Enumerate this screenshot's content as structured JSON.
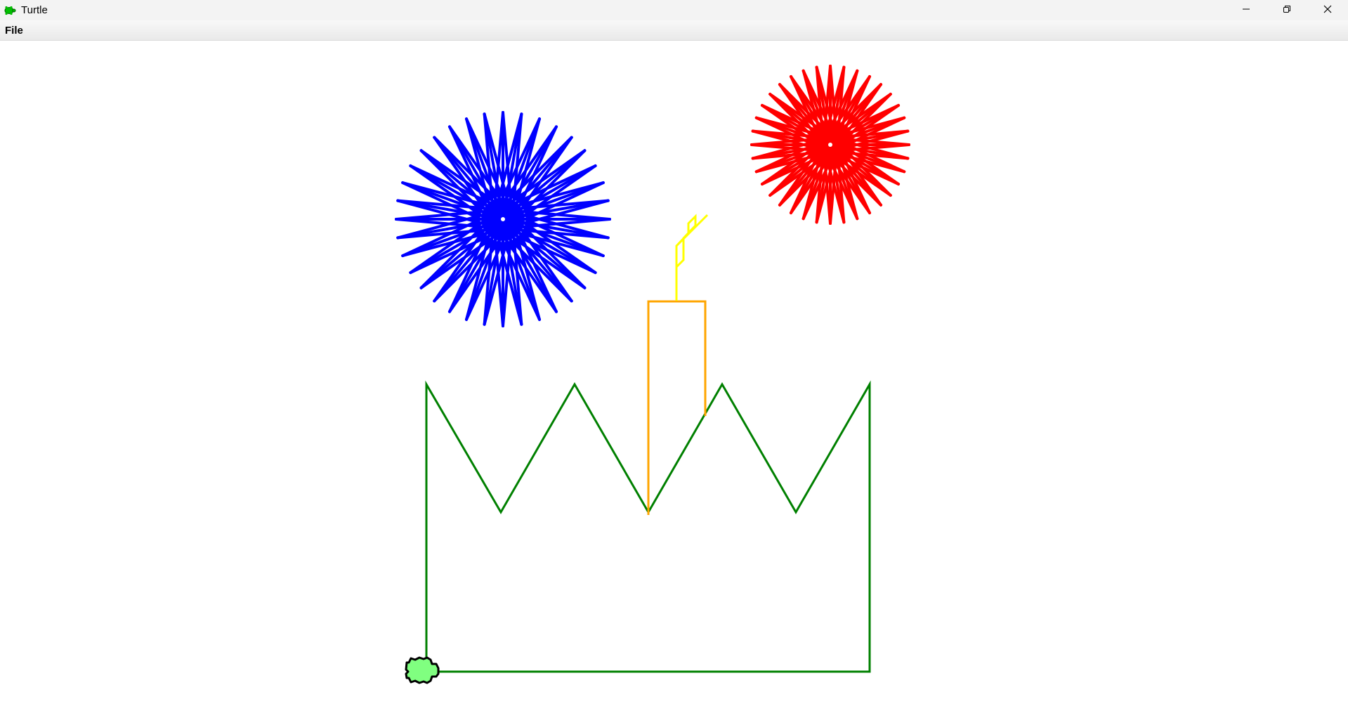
{
  "window": {
    "title": "Turtle",
    "app_icon": "turtle-icon",
    "controls": [
      "minimize-icon",
      "restore-icon",
      "close-icon"
    ]
  },
  "menu": {
    "items": [
      {
        "label": "File"
      }
    ]
  },
  "drawing": {
    "colors": {
      "blue_burst": "#0000ff",
      "red_burst": "#ff0000",
      "candle": "#ffa500",
      "flame": "#ffff00",
      "crown": "#008000",
      "turtle_fill": "#80ff80",
      "turtle_outline": "#000000"
    },
    "burst_ray_count": 36
  }
}
